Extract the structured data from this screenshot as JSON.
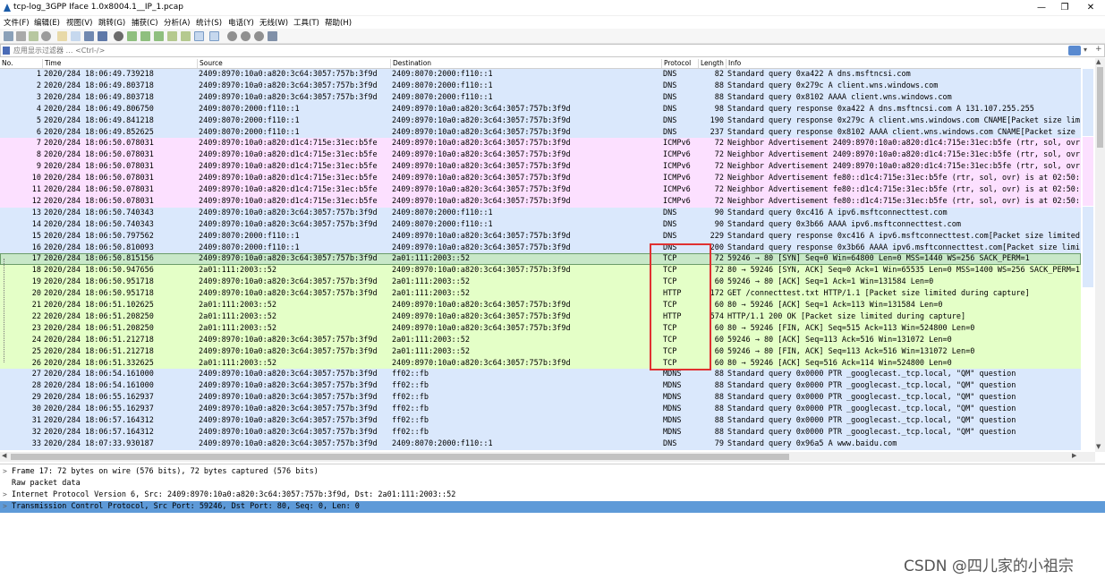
{
  "window": {
    "title": "tcp-log_3GPP  Iface 1.0x8004.1__IP_1.pcap",
    "minimize": "—",
    "maximize": "❐",
    "close": "✕"
  },
  "menu": [
    "文件(F)",
    "编辑(E)",
    "视图(V)",
    "跳转(G)",
    "捕获(C)",
    "分析(A)",
    "统计(S)",
    "电话(Y)",
    "无线(W)",
    "工具(T)",
    "帮助(H)"
  ],
  "filter": {
    "placeholder": "应用显示过滤器 … <Ctrl-/>"
  },
  "columns": {
    "no": "No.",
    "time": "Time",
    "source": "Source",
    "destination": "Destination",
    "protocol": "Protocol",
    "length": "Length",
    "info": "Info"
  },
  "colors": {
    "dns": "#dae8fc",
    "icmpv6": "#fce0ff",
    "tcp": "#e4ffc7",
    "tcp_selected": "#c8e8c8",
    "mdns": "#dae8fc",
    "highlight": "#5e9ad8",
    "red_box": "#e03030"
  },
  "packets": [
    {
      "no": "1",
      "time": "2020/284 18:06:49.739218",
      "src": "2409:8970:10a0:a820:3c64:3057:757b:3f9d",
      "dst": "2409:8070:2000:f110::1",
      "proto": "DNS",
      "len": "82",
      "info": "Standard query 0xa422 A dns.msftncsi.com"
    },
    {
      "no": "2",
      "time": "2020/284 18:06:49.803718",
      "src": "2409:8970:10a0:a820:3c64:3057:757b:3f9d",
      "dst": "2409:8070:2000:f110::1",
      "proto": "DNS",
      "len": "88",
      "info": "Standard query 0x279c A client.wns.windows.com"
    },
    {
      "no": "3",
      "time": "2020/284 18:06:49.803718",
      "src": "2409:8970:10a0:a820:3c64:3057:757b:3f9d",
      "dst": "2409:8070:2000:f110::1",
      "proto": "DNS",
      "len": "88",
      "info": "Standard query 0x8102 AAAA client.wns.windows.com"
    },
    {
      "no": "4",
      "time": "2020/284 18:06:49.806750",
      "src": "2409:8070:2000:f110::1",
      "dst": "2409:8970:10a0:a820:3c64:3057:757b:3f9d",
      "proto": "DNS",
      "len": "98",
      "info": "Standard query response 0xa422 A dns.msftncsi.com A 131.107.255.255"
    },
    {
      "no": "5",
      "time": "2020/284 18:06:49.841218",
      "src": "2409:8070:2000:f110::1",
      "dst": "2409:8970:10a0:a820:3c64:3057:757b:3f9d",
      "proto": "DNS",
      "len": "190",
      "info": "Standard query response 0x279c A client.wns.windows.com CNAME[Packet size lim"
    },
    {
      "no": "6",
      "time": "2020/284 18:06:49.852625",
      "src": "2409:8070:2000:f110::1",
      "dst": "2409:8970:10a0:a820:3c64:3057:757b:3f9d",
      "proto": "DNS",
      "len": "237",
      "info": "Standard query response 0x8102 AAAA client.wns.windows.com CNAME[Packet size"
    },
    {
      "no": "7",
      "time": "2020/284 18:06:50.078031",
      "src": "2409:8970:10a0:a820:d1c4:715e:31ec:b5fe",
      "dst": "2409:8970:10a0:a820:3c64:3057:757b:3f9d",
      "proto": "ICMPv6",
      "len": "72",
      "info": "Neighbor Advertisement 2409:8970:10a0:a820:d1c4:715e:31ec:b5fe (rtr, sol, ovr"
    },
    {
      "no": "8",
      "time": "2020/284 18:06:50.078031",
      "src": "2409:8970:10a0:a820:d1c4:715e:31ec:b5fe",
      "dst": "2409:8970:10a0:a820:3c64:3057:757b:3f9d",
      "proto": "ICMPv6",
      "len": "72",
      "info": "Neighbor Advertisement 2409:8970:10a0:a820:d1c4:715e:31ec:b5fe (rtr, sol, ovr"
    },
    {
      "no": "9",
      "time": "2020/284 18:06:50.078031",
      "src": "2409:8970:10a0:a820:d1c4:715e:31ec:b5fe",
      "dst": "2409:8970:10a0:a820:3c64:3057:757b:3f9d",
      "proto": "ICMPv6",
      "len": "72",
      "info": "Neighbor Advertisement 2409:8970:10a0:a820:d1c4:715e:31ec:b5fe (rtr, sol, ovr"
    },
    {
      "no": "10",
      "time": "2020/284 18:06:50.078031",
      "src": "2409:8970:10a0:a820:d1c4:715e:31ec:b5fe",
      "dst": "2409:8970:10a0:a820:3c64:3057:757b:3f9d",
      "proto": "ICMPv6",
      "len": "72",
      "info": "Neighbor Advertisement fe80::d1c4:715e:31ec:b5fe (rtr, sol, ovr) is at 02:50:"
    },
    {
      "no": "11",
      "time": "2020/284 18:06:50.078031",
      "src": "2409:8970:10a0:a820:d1c4:715e:31ec:b5fe",
      "dst": "2409:8970:10a0:a820:3c64:3057:757b:3f9d",
      "proto": "ICMPv6",
      "len": "72",
      "info": "Neighbor Advertisement fe80::d1c4:715e:31ec:b5fe (rtr, sol, ovr) is at 02:50:"
    },
    {
      "no": "12",
      "time": "2020/284 18:06:50.078031",
      "src": "2409:8970:10a0:a820:d1c4:715e:31ec:b5fe",
      "dst": "2409:8970:10a0:a820:3c64:3057:757b:3f9d",
      "proto": "ICMPv6",
      "len": "72",
      "info": "Neighbor Advertisement fe80::d1c4:715e:31ec:b5fe (rtr, sol, ovr) is at 02:50:"
    },
    {
      "no": "13",
      "time": "2020/284 18:06:50.740343",
      "src": "2409:8970:10a0:a820:3c64:3057:757b:3f9d",
      "dst": "2409:8070:2000:f110::1",
      "proto": "DNS",
      "len": "90",
      "info": "Standard query 0xc416 A ipv6.msftconnecttest.com"
    },
    {
      "no": "14",
      "time": "2020/284 18:06:50.740343",
      "src": "2409:8970:10a0:a820:3c64:3057:757b:3f9d",
      "dst": "2409:8070:2000:f110::1",
      "proto": "DNS",
      "len": "90",
      "info": "Standard query 0x3b66 AAAA ipv6.msftconnecttest.com"
    },
    {
      "no": "15",
      "time": "2020/284 18:06:50.797562",
      "src": "2409:8070:2000:f110::1",
      "dst": "2409:8970:10a0:a820:3c64:3057:757b:3f9d",
      "proto": "DNS",
      "len": "229",
      "info": "Standard query response 0xc416 A ipv6.msftconnecttest.com[Packet size limited"
    },
    {
      "no": "16",
      "time": "2020/284 18:06:50.810093",
      "src": "2409:8070:2000:f110::1",
      "dst": "2409:8970:10a0:a820:3c64:3057:757b:3f9d",
      "proto": "DNS",
      "len": "200",
      "info": "Standard query response 0x3b66 AAAA ipv6.msftconnecttest.com[Packet size limi"
    },
    {
      "no": "17",
      "time": "2020/284 18:06:50.815156",
      "src": "2409:8970:10a0:a820:3c64:3057:757b:3f9d",
      "dst": "2a01:111:2003::52",
      "proto": "TCP",
      "len": "72",
      "info": "59246 → 80 [SYN] Seq=0 Win=64800 Len=0 MSS=1440 WS=256 SACK_PERM=1"
    },
    {
      "no": "18",
      "time": "2020/284 18:06:50.947656",
      "src": "2a01:111:2003::52",
      "dst": "2409:8970:10a0:a820:3c64:3057:757b:3f9d",
      "proto": "TCP",
      "len": "72",
      "info": "80 → 59246 [SYN, ACK] Seq=0 Ack=1 Win=65535 Len=0 MSS=1400 WS=256 SACK_PERM=1"
    },
    {
      "no": "19",
      "time": "2020/284 18:06:50.951718",
      "src": "2409:8970:10a0:a820:3c64:3057:757b:3f9d",
      "dst": "2a01:111:2003::52",
      "proto": "TCP",
      "len": "60",
      "info": "59246 → 80 [ACK] Seq=1 Ack=1 Win=131584 Len=0"
    },
    {
      "no": "20",
      "time": "2020/284 18:06:50.951718",
      "src": "2409:8970:10a0:a820:3c64:3057:757b:3f9d",
      "dst": "2a01:111:2003::52",
      "proto": "HTTP",
      "len": "172",
      "info": "GET /connecttest.txt HTTP/1.1 [Packet size limited during capture]"
    },
    {
      "no": "21",
      "time": "2020/284 18:06:51.102625",
      "src": "2a01:111:2003::52",
      "dst": "2409:8970:10a0:a820:3c64:3057:757b:3f9d",
      "proto": "TCP",
      "len": "60",
      "info": "80 → 59246 [ACK] Seq=1 Ack=113 Win=131584 Len=0"
    },
    {
      "no": "22",
      "time": "2020/284 18:06:51.208250",
      "src": "2a01:111:2003::52",
      "dst": "2409:8970:10a0:a820:3c64:3057:757b:3f9d",
      "proto": "HTTP",
      "len": "574",
      "info": "HTTP/1.1 200 OK [Packet size limited during capture]"
    },
    {
      "no": "23",
      "time": "2020/284 18:06:51.208250",
      "src": "2a01:111:2003::52",
      "dst": "2409:8970:10a0:a820:3c64:3057:757b:3f9d",
      "proto": "TCP",
      "len": "60",
      "info": "80 → 59246 [FIN, ACK] Seq=515 Ack=113 Win=524800 Len=0"
    },
    {
      "no": "24",
      "time": "2020/284 18:06:51.212718",
      "src": "2409:8970:10a0:a820:3c64:3057:757b:3f9d",
      "dst": "2a01:111:2003::52",
      "proto": "TCP",
      "len": "60",
      "info": "59246 → 80 [ACK] Seq=113 Ack=516 Win=131072 Len=0"
    },
    {
      "no": "25",
      "time": "2020/284 18:06:51.212718",
      "src": "2409:8970:10a0:a820:3c64:3057:757b:3f9d",
      "dst": "2a01:111:2003::52",
      "proto": "TCP",
      "len": "60",
      "info": "59246 → 80 [FIN, ACK] Seq=113 Ack=516 Win=131072 Len=0"
    },
    {
      "no": "26",
      "time": "2020/284 18:06:51.332625",
      "src": "2a01:111:2003::52",
      "dst": "2409:8970:10a0:a820:3c64:3057:757b:3f9d",
      "proto": "TCP",
      "len": "60",
      "info": "80 → 59246 [ACK] Seq=516 Ack=114 Win=524800 Len=0"
    },
    {
      "no": "27",
      "time": "2020/284 18:06:54.161000",
      "src": "2409:8970:10a0:a820:3c64:3057:757b:3f9d",
      "dst": "ff02::fb",
      "proto": "MDNS",
      "len": "88",
      "info": "Standard query 0x0000 PTR _googlecast._tcp.local, \"QM\" question"
    },
    {
      "no": "28",
      "time": "2020/284 18:06:54.161000",
      "src": "2409:8970:10a0:a820:3c64:3057:757b:3f9d",
      "dst": "ff02::fb",
      "proto": "MDNS",
      "len": "88",
      "info": "Standard query 0x0000 PTR _googlecast._tcp.local, \"QM\" question"
    },
    {
      "no": "29",
      "time": "2020/284 18:06:55.162937",
      "src": "2409:8970:10a0:a820:3c64:3057:757b:3f9d",
      "dst": "ff02::fb",
      "proto": "MDNS",
      "len": "88",
      "info": "Standard query 0x0000 PTR _googlecast._tcp.local, \"QM\" question"
    },
    {
      "no": "30",
      "time": "2020/284 18:06:55.162937",
      "src": "2409:8970:10a0:a820:3c64:3057:757b:3f9d",
      "dst": "ff02::fb",
      "proto": "MDNS",
      "len": "88",
      "info": "Standard query 0x0000 PTR _googlecast._tcp.local, \"QM\" question"
    },
    {
      "no": "31",
      "time": "2020/284 18:06:57.164312",
      "src": "2409:8970:10a0:a820:3c64:3057:757b:3f9d",
      "dst": "ff02::fb",
      "proto": "MDNS",
      "len": "88",
      "info": "Standard query 0x0000 PTR _googlecast._tcp.local, \"QM\" question"
    },
    {
      "no": "32",
      "time": "2020/284 18:06:57.164312",
      "src": "2409:8970:10a0:a820:3c64:3057:757b:3f9d",
      "dst": "ff02::fb",
      "proto": "MDNS",
      "len": "88",
      "info": "Standard query 0x0000 PTR _googlecast._tcp.local, \"QM\" question"
    },
    {
      "no": "33",
      "time": "2020/284 18:07:33.930187",
      "src": "2409:8970:10a0:a820:3c64:3057:757b:3f9d",
      "dst": "2409:8070:2000:f110::1",
      "proto": "DNS",
      "len": "79",
      "info": "Standard query 0x96a5 A www.baidu.com"
    }
  ],
  "details": [
    {
      "arrow": ">",
      "text": "Frame 17: 72 bytes on wire (576 bits), 72 bytes captured (576 bits)"
    },
    {
      "arrow": "",
      "text": "Raw packet data"
    },
    {
      "arrow": ">",
      "text": "Internet Protocol Version 6, Src: 2409:8970:10a0:a820:3c64:3057:757b:3f9d, Dst: 2a01:111:2003::52"
    },
    {
      "arrow": ">",
      "text": "Transmission Control Protocol, Src Port: 59246, Dst Port: 80, Seq: 0, Len: 0"
    }
  ],
  "watermark": "CSDN @四儿家的小祖宗"
}
